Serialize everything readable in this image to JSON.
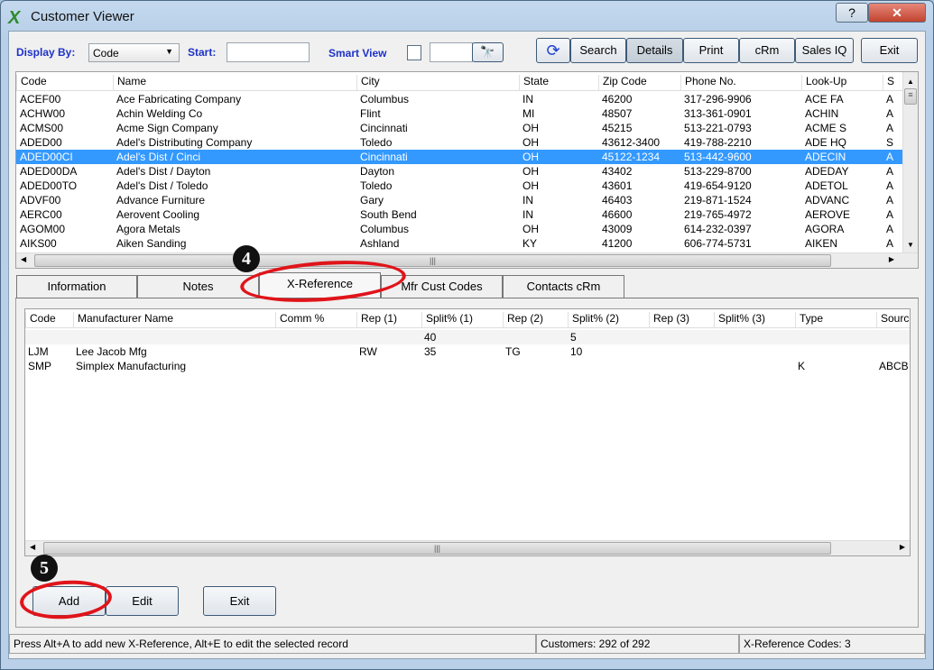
{
  "window": {
    "title": "Customer Viewer",
    "help": "?",
    "close": "✕"
  },
  "toolbar": {
    "display_by_label": "Display By:",
    "display_by_value": "Code",
    "start_label": "Start:",
    "start_value": "",
    "smart_view_label": "Smart View",
    "smart_view_value": "",
    "buttons": {
      "refresh": "⟳",
      "search": "Search",
      "details": "Details",
      "print": "Print",
      "crm": "cRm",
      "sales_iq": "Sales IQ",
      "exit": "Exit"
    }
  },
  "customers": {
    "columns": [
      "Code",
      "Name",
      "City",
      "State",
      "Zip Code",
      "Phone No.",
      "Look-Up",
      "S"
    ],
    "rows": [
      [
        "ACEF00",
        "Ace Fabricating Company",
        "Columbus",
        "IN",
        "46200",
        "317-296-9906",
        "ACE FA",
        "A"
      ],
      [
        "ACHW00",
        "Achin Welding Co",
        "Flint",
        "MI",
        "48507",
        "313-361-0901",
        "ACHIN",
        "A"
      ],
      [
        "ACMS00",
        "Acme Sign Company",
        "Cincinnati",
        "OH",
        "45215",
        "513-221-0793",
        "ACME S",
        "A"
      ],
      [
        "ADED00",
        "Adel's Distributing Company",
        "Toledo",
        "OH",
        "43612-3400",
        "419-788-2210",
        "ADE HQ",
        "S"
      ],
      [
        "ADED00CI",
        "Adel's Dist / Cinci",
        "Cincinnati",
        "OH",
        "45122-1234",
        "513-442-9600",
        "ADECIN",
        "A"
      ],
      [
        "ADED00DA",
        "Adel's Dist / Dayton",
        "Dayton",
        "OH",
        "43402",
        "513-229-8700",
        "ADEDAY",
        "A"
      ],
      [
        "ADED00TO",
        "Adel's Dist / Toledo",
        "Toledo",
        "OH",
        "43601",
        "419-654-9120",
        "ADETOL",
        "A"
      ],
      [
        "ADVF00",
        "Advance Furniture",
        "Gary",
        "IN",
        "46403",
        "219-871-1524",
        "ADVANC",
        "A"
      ],
      [
        "AERC00",
        "Aerovent Cooling",
        "South Bend",
        "IN",
        "46600",
        "219-765-4972",
        "AEROVE",
        "A"
      ],
      [
        "AGOM00",
        "Agora Metals",
        "Columbus",
        "OH",
        "43009",
        "614-232-0397",
        "AGORA",
        "A"
      ],
      [
        "AIKS00",
        "Aiken Sanding",
        "Ashland",
        "KY",
        "41200",
        "606-774-5731",
        "AIKEN",
        "A"
      ]
    ],
    "selected_index": 4
  },
  "tabs": [
    "Information",
    "Notes",
    "X-Reference",
    "Mfr Cust Codes",
    "Contacts cRm"
  ],
  "active_tab": "X-Reference",
  "xref": {
    "columns": [
      "Code",
      "Manufacturer Name",
      "Comm %",
      "Rep (1)",
      "Split% (1)",
      "Rep (2)",
      "Split% (2)",
      "Rep (3)",
      "Split% (3)",
      "Type",
      "Source"
    ],
    "rows": [
      [
        "",
        "",
        "",
        "",
        "40",
        "",
        "5",
        "",
        "",
        "",
        ""
      ],
      [
        "LJM",
        "Lee Jacob Mfg",
        "",
        "RW",
        "35",
        "TG",
        "10",
        "",
        "",
        "",
        ""
      ],
      [
        "SMP",
        "Simplex Manufacturing",
        "",
        "",
        "",
        "",
        "",
        "",
        "",
        "K",
        "ABCB"
      ]
    ]
  },
  "actions": {
    "add": "Add",
    "edit": "Edit",
    "exit": "Exit"
  },
  "callouts": {
    "step4": "4",
    "step5": "5"
  },
  "status": {
    "hint": "Press Alt+A to add new X-Reference,   Alt+E to edit the selected record",
    "customers": "Customers: 292 of 292",
    "xref_count": "X-Reference Codes: 3"
  },
  "colors": {
    "selection": "#3399ff",
    "label": "#1e32c8",
    "callout": "#e0141a"
  }
}
